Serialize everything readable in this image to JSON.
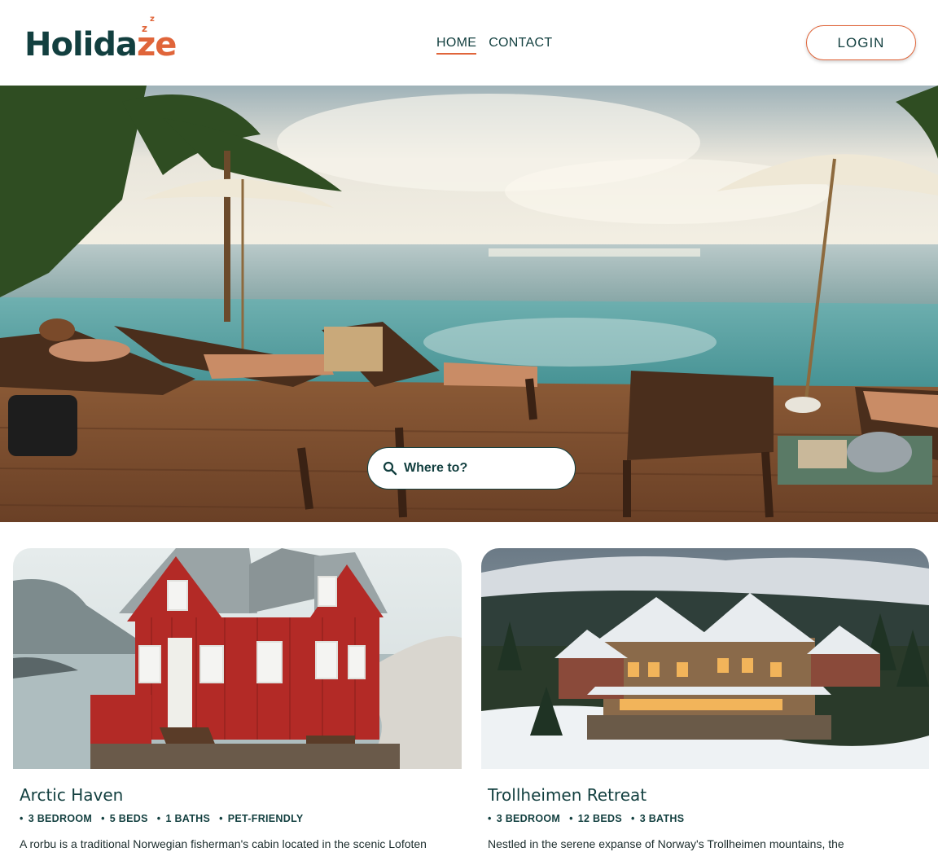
{
  "header": {
    "logo": {
      "text_main": "Holid",
      "text_accent": "ze",
      "text_a": "a",
      "z_marks": "zz"
    },
    "nav": [
      {
        "label": "HOME",
        "active": true
      },
      {
        "label": "CONTACT",
        "active": false
      }
    ],
    "login_label": "LOGIN"
  },
  "hero": {
    "search_placeholder": "Where to?",
    "search_icon": "search-icon"
  },
  "cards": [
    {
      "title": "Arctic Haven",
      "features": [
        "3 BEDROOM",
        "5 BEDS",
        "1 BATHS",
        "PET-FRIENDLY"
      ],
      "description": "A rorbu is a traditional Norwegian fisherman's cabin located in the scenic Lofoten"
    },
    {
      "title": "Trollheimen Retreat",
      "features": [
        "3 BEDROOM",
        "12 BEDS",
        "3 BATHS"
      ],
      "description": "Nestled in the serene expanse of Norway's Trollheimen mountains, the Trollheimen"
    }
  ],
  "colors": {
    "brand": "#123f3f",
    "accent": "#e0653a"
  }
}
